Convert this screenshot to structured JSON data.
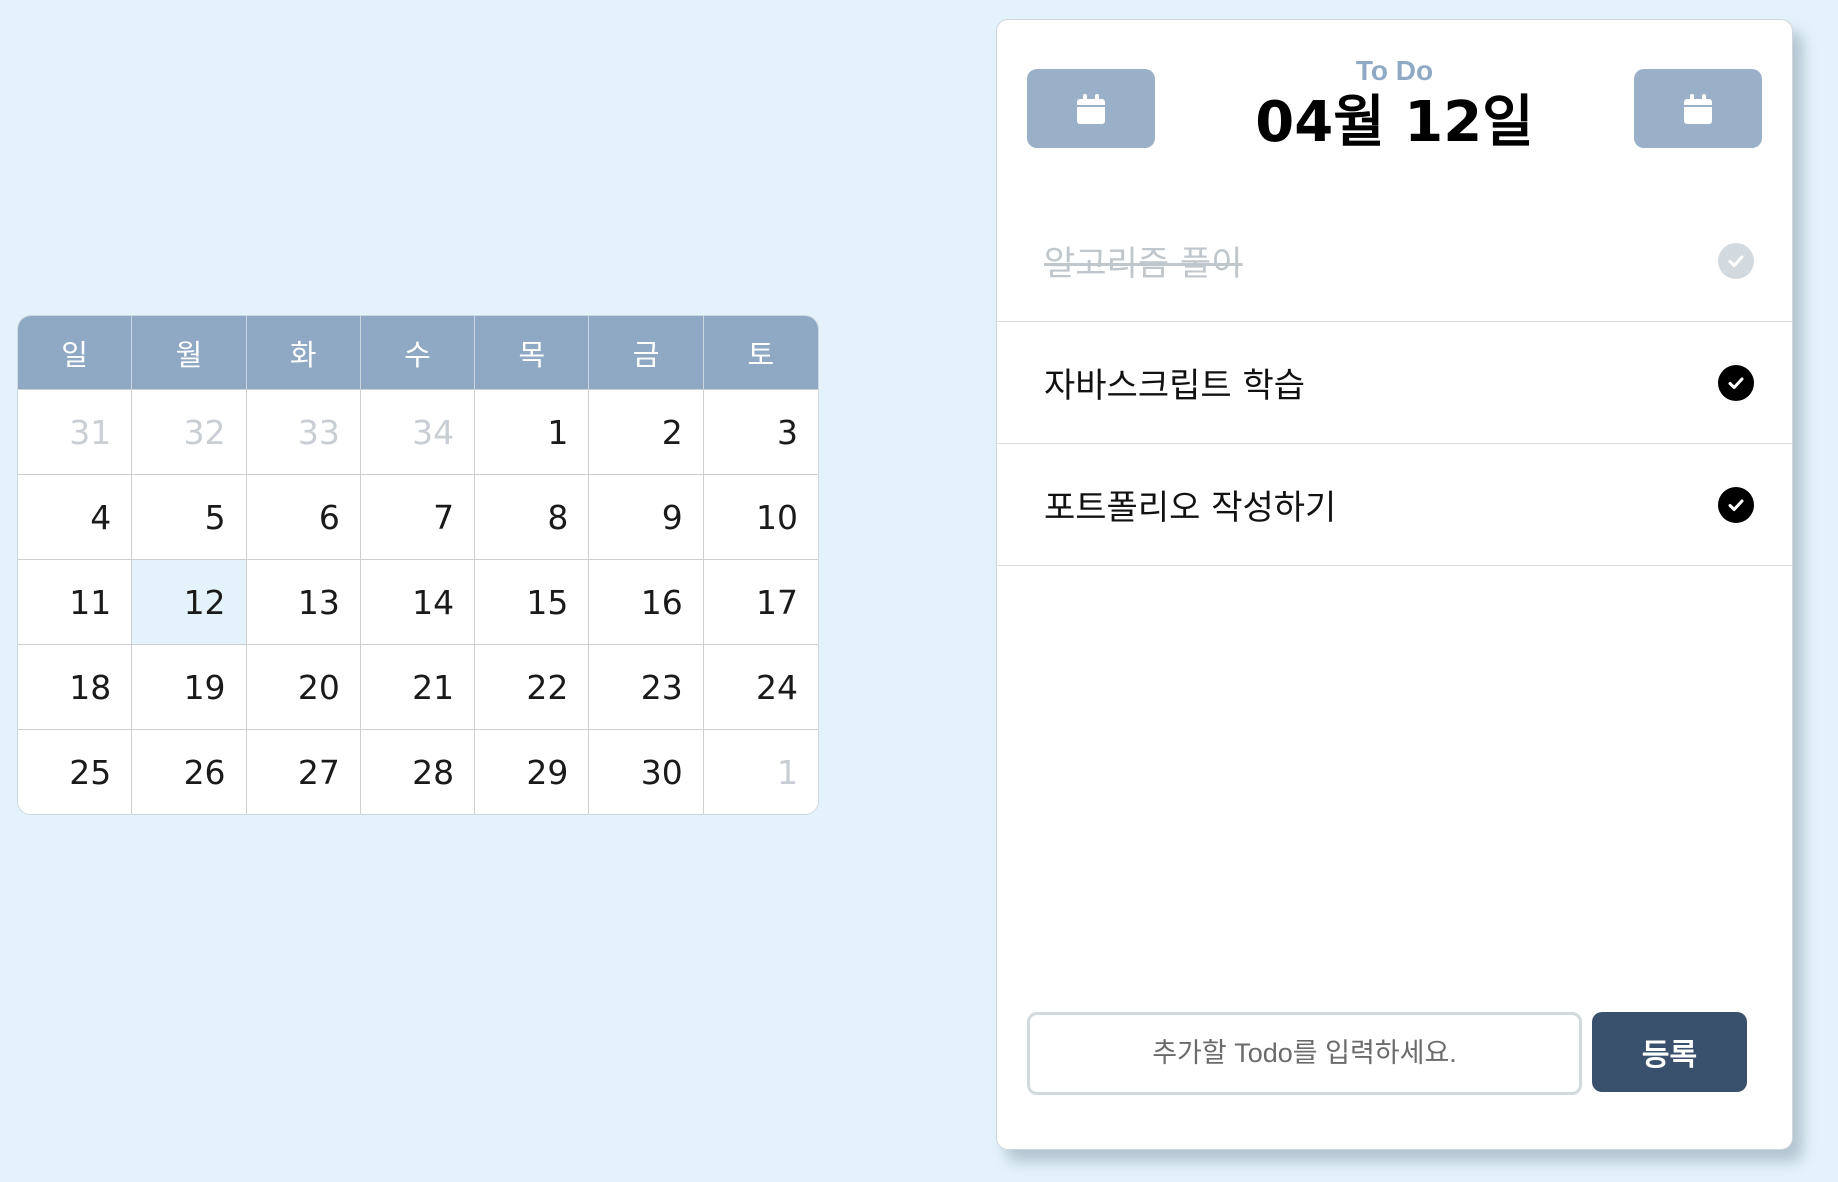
{
  "calendar": {
    "weekdays": [
      "일",
      "월",
      "화",
      "수",
      "목",
      "금",
      "토"
    ],
    "weeks": [
      [
        {
          "d": "31",
          "muted": true
        },
        {
          "d": "32",
          "muted": true
        },
        {
          "d": "33",
          "muted": true
        },
        {
          "d": "34",
          "muted": true
        },
        {
          "d": "1"
        },
        {
          "d": "2"
        },
        {
          "d": "3"
        }
      ],
      [
        {
          "d": "4"
        },
        {
          "d": "5"
        },
        {
          "d": "6"
        },
        {
          "d": "7"
        },
        {
          "d": "8"
        },
        {
          "d": "9"
        },
        {
          "d": "10"
        }
      ],
      [
        {
          "d": "11"
        },
        {
          "d": "12",
          "selected": true
        },
        {
          "d": "13"
        },
        {
          "d": "14"
        },
        {
          "d": "15"
        },
        {
          "d": "16"
        },
        {
          "d": "17"
        }
      ],
      [
        {
          "d": "18"
        },
        {
          "d": "19"
        },
        {
          "d": "20"
        },
        {
          "d": "21"
        },
        {
          "d": "22"
        },
        {
          "d": "23"
        },
        {
          "d": "24"
        }
      ],
      [
        {
          "d": "25"
        },
        {
          "d": "26"
        },
        {
          "d": "27"
        },
        {
          "d": "28"
        },
        {
          "d": "29"
        },
        {
          "d": "30"
        },
        {
          "d": "1",
          "muted": true
        }
      ]
    ]
  },
  "todo": {
    "subtitle": "To Do",
    "date_title": "04월 12일",
    "prev_icon": "calendar-icon",
    "next_icon": "calendar-icon",
    "items": [
      {
        "text": "알고리즘 풀이",
        "done": true
      },
      {
        "text": "자바스크립트 학습",
        "done": false
      },
      {
        "text": "포트폴리오 작성하기",
        "done": false
      }
    ],
    "input_placeholder": "추가할 Todo를 입력하세요.",
    "input_value": "",
    "submit_label": "등록"
  },
  "colors": {
    "background": "#e4f3fb",
    "calendar_header": "#8fa9c5",
    "nav_button": "#9ab0c8",
    "submit_button": "#3a516d",
    "subtitle": "#8fa9c5"
  }
}
